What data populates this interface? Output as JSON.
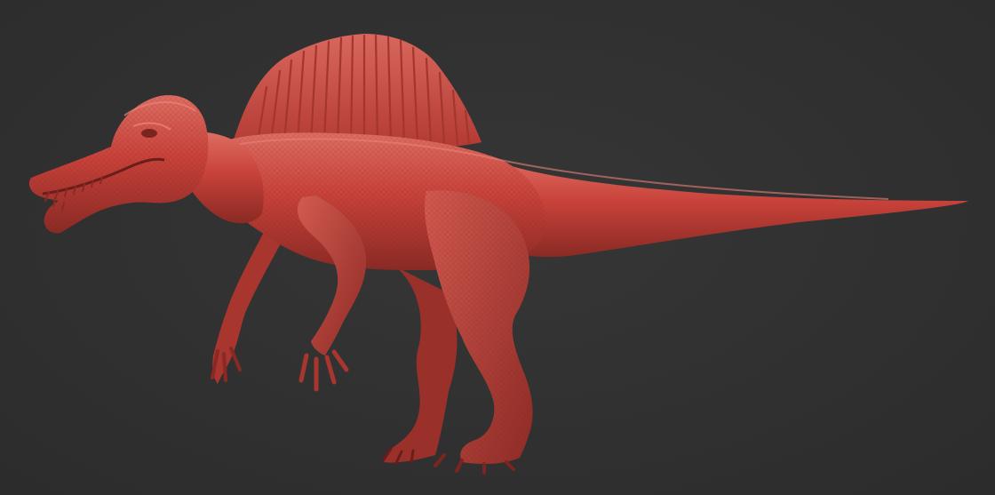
{
  "viewport": {
    "background_color": "#313131"
  },
  "model": {
    "subject": "spinosaurus-sculpt",
    "material_color": "#c8423a",
    "highlight_color": "#e0756b",
    "shadow_color": "#7e2420"
  }
}
